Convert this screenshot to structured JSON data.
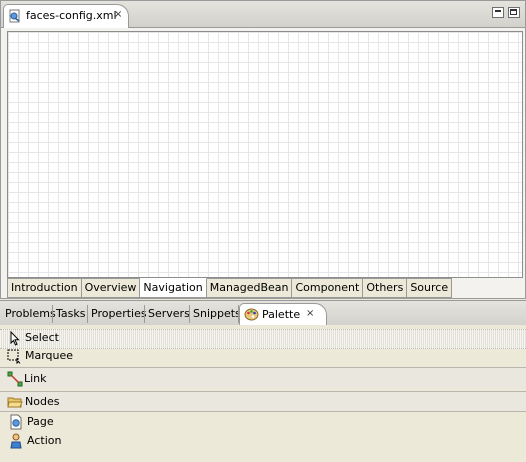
{
  "editor": {
    "tab_title": "faces-config.xml",
    "page_tabs": [
      "Introduction",
      "Overview",
      "Navigation",
      "ManagedBean",
      "Component",
      "Others",
      "Source"
    ],
    "active_page_tab": "Navigation"
  },
  "views": {
    "tabs": [
      "Problems",
      "Tasks",
      "Properties",
      "Servers",
      "Snippets"
    ],
    "active_tab": "Palette"
  },
  "palette": {
    "select": "Select",
    "marquee": "Marquee",
    "link": "Link",
    "nodes_drawer": "Nodes",
    "page": "Page",
    "action": "Action"
  },
  "icons": {
    "close": "×",
    "minimize": "minimize-icon",
    "maximize": "maximize-icon"
  }
}
